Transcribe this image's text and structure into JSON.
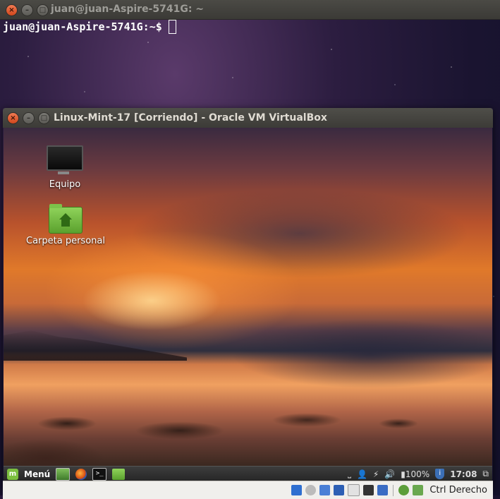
{
  "terminal": {
    "title": "juan@juan-Aspire-5741G: ~",
    "prompt": "juan@juan-Aspire-5741G:~$"
  },
  "vbox_window": {
    "title": "Linux-Mint-17 [Corriendo] - Oracle VM VirtualBox",
    "desktop_icons": [
      {
        "label": "Equipo",
        "icon": "computer-icon"
      },
      {
        "label": "Carpeta personal",
        "icon": "home-folder-icon"
      }
    ],
    "panel": {
      "menu_label": "Menú",
      "battery": "100%",
      "clock": "17:08"
    },
    "statusbar": {
      "host_key": "Ctrl Derecho"
    }
  },
  "colors": {
    "titlebar": "#3c3b37",
    "close_button": "#d2471c",
    "mint_green": "#7cbf3f"
  }
}
